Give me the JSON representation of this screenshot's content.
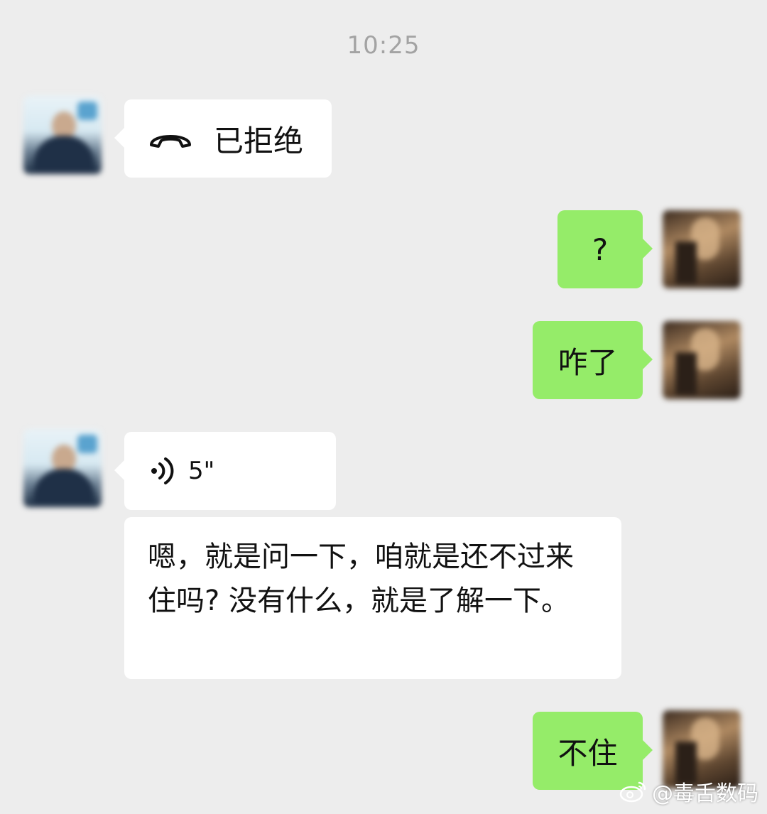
{
  "timestamp": "10:25",
  "messages": [
    {
      "side": "left",
      "type": "call",
      "icon": "phone-hangup-icon",
      "text": "已拒绝"
    },
    {
      "side": "right",
      "type": "text",
      "text": "?"
    },
    {
      "side": "right",
      "type": "text",
      "text": "咋了"
    },
    {
      "side": "left",
      "type": "voice",
      "icon": "voice-icon",
      "duration": "5\""
    },
    {
      "side": "left",
      "type": "text",
      "text": "嗯，就是问一下，咱就是还不过来住吗? 没有什么，就是了解一下。"
    },
    {
      "side": "right",
      "type": "text",
      "text": "不住"
    }
  ],
  "watermark": {
    "icon": "weibo-icon",
    "text": "@毒舌数码"
  },
  "colors": {
    "background": "#ededed",
    "sent_bubble": "#95ec69",
    "received_bubble": "#ffffff"
  }
}
